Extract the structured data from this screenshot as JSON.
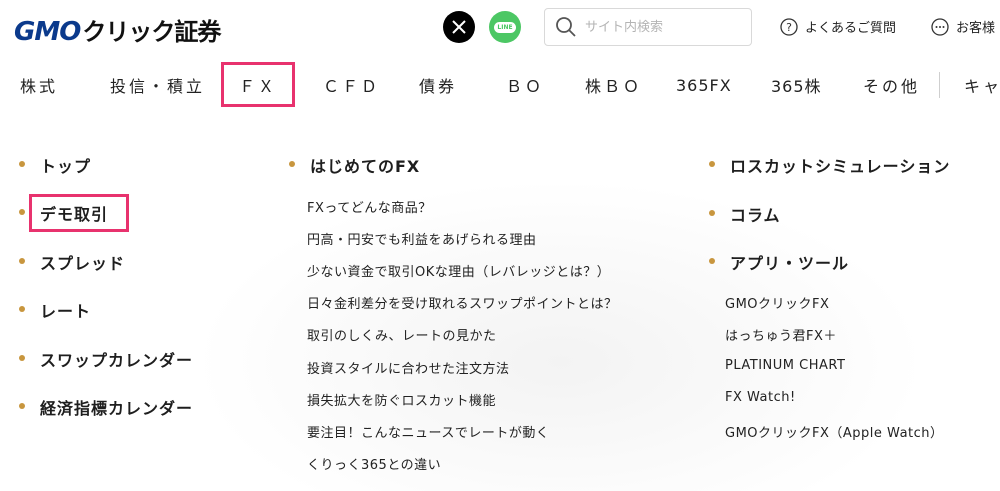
{
  "header": {
    "logo_gmo": "GMO",
    "logo_jp": "クリック証券",
    "search_placeholder": "サイト内検索",
    "faq_label": "よくあるご質問",
    "support_label": "お客様"
  },
  "nav": {
    "items": [
      "株式",
      "投信・積立",
      "ＦＸ",
      "ＣＦＤ",
      "債券",
      "ＢＯ",
      "株ＢＯ",
      "365FX",
      "365株",
      "その他",
      "キャ"
    ]
  },
  "menu": {
    "col1": [
      "トップ",
      "デモ取引",
      "スプレッド",
      "レート",
      "スワップカレンダー",
      "経済指標カレンダー"
    ],
    "col2_heading": "はじめてのFX",
    "col2_links": [
      "FXってどんな商品？",
      "円高・円安でも利益をあげられる理由",
      "少ない資金で取引OKな理由（レバレッジとは？）",
      "日々金利差分を受け取れるスワップポイントとは？",
      "取引のしくみ、レートの見かた",
      "投資スタイルに合わせた注文方法",
      "損失拡大を防ぐロスカット機能",
      "要注目！こんなニュースでレートが動く",
      "くりっく365との違い"
    ],
    "col3": [
      "ロスカットシミュレーション",
      "コラム",
      "アプリ・ツール"
    ],
    "col3_links": [
      "GMOクリックFX",
      "はっちゅう君FX＋",
      "PLATINUM CHART",
      "FX Watch!",
      "GMOクリックFX（Apple Watch）"
    ]
  },
  "colors": {
    "accent": "#e8326e",
    "bullet": "#c8963e",
    "brand": "#0b3a8c",
    "line": "#4cc764"
  },
  "icons": [
    "x-logo-icon",
    "line-logo-icon",
    "search-icon",
    "help-icon",
    "chat-icon"
  ]
}
